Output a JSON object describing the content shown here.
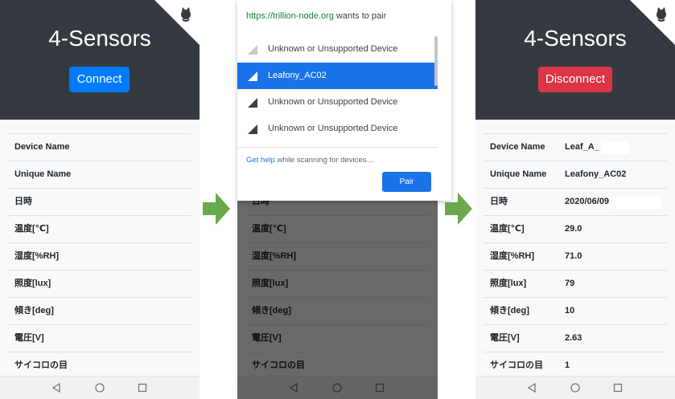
{
  "left": {
    "title": "4-Sensors",
    "button": "Connect",
    "rows": [
      {
        "label": "Device Name"
      },
      {
        "label": "Unique Name"
      },
      {
        "label": "日時"
      },
      {
        "label": "温度[℃]"
      },
      {
        "label": "湿度[%RH]"
      },
      {
        "label": "照度[lux]"
      },
      {
        "label": "傾き[deg]"
      },
      {
        "label": "電圧[V]"
      },
      {
        "label": "サイコロの目"
      }
    ]
  },
  "middle": {
    "rows": [
      {
        "label": "日時"
      },
      {
        "label": "温度[℃]"
      },
      {
        "label": "湿度[%RH]"
      },
      {
        "label": "照度[lux]"
      },
      {
        "label": "傾き[deg]"
      },
      {
        "label": "電圧[V]"
      },
      {
        "label": "サイコロの目"
      }
    ],
    "dialog": {
      "origin": "https://trillion-node.org",
      "suffix": " wants to pair",
      "devices": [
        {
          "name": "Unknown or Unsupported Device",
          "selected": false
        },
        {
          "name": "Leafony_AC02",
          "selected": true
        },
        {
          "name": "Unknown or Unsupported Device",
          "selected": false
        },
        {
          "name": "Unknown or Unsupported Device",
          "selected": false
        }
      ],
      "help_link": "Get help",
      "help_text": " while scanning for devices…",
      "pair_button": "Pair"
    }
  },
  "right": {
    "title": "4-Sensors",
    "button": "Disconnect",
    "rows": [
      {
        "label": "Device Name",
        "value": "Leaf_A_"
      },
      {
        "label": "Unique Name",
        "value": "Leafony_AC02"
      },
      {
        "label": "日時",
        "value": "2020/06/09"
      },
      {
        "label": "温度[℃]",
        "value": "29.0"
      },
      {
        "label": "湿度[%RH]",
        "value": "71.0"
      },
      {
        "label": "照度[lux]",
        "value": "79"
      },
      {
        "label": "傾き[deg]",
        "value": "10"
      },
      {
        "label": "電圧[V]",
        "value": "2.63"
      },
      {
        "label": "サイコロの目",
        "value": "1"
      }
    ]
  },
  "colors": {
    "header": "#343a40",
    "connect": "#007bff",
    "disconnect": "#dc3545",
    "arrow": "#6aa84f",
    "selected": "#1a73e8"
  },
  "icons": [
    "github-corner-icon",
    "back-icon",
    "home-icon",
    "recents-icon",
    "signal-icon",
    "arrow-right-icon"
  ]
}
